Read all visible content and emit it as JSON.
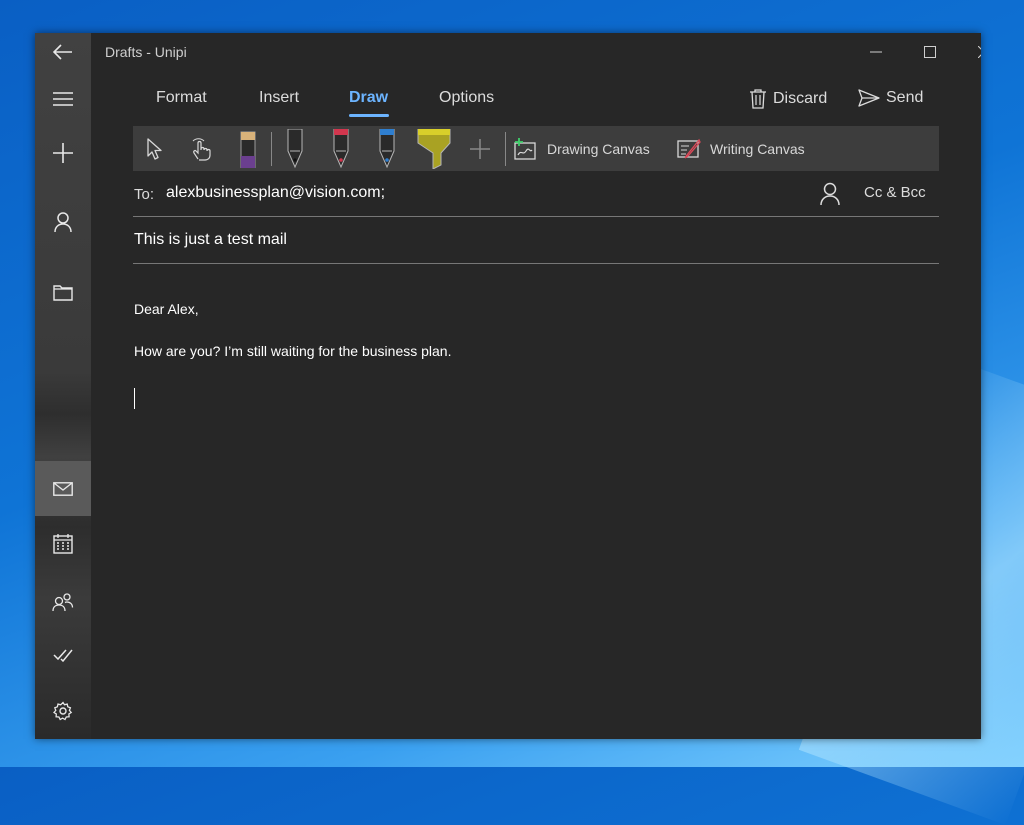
{
  "window": {
    "title": "Drafts - Unipi"
  },
  "rail": {
    "items": [
      {
        "name": "back-button",
        "icon": "back-arrow-icon"
      },
      {
        "name": "menu-button",
        "icon": "hamburger-icon"
      },
      {
        "name": "new-mail-button",
        "icon": "plus-icon"
      },
      {
        "name": "accounts-button",
        "icon": "person-icon"
      },
      {
        "name": "folders-button",
        "icon": "folder-icon"
      },
      {
        "name": "mail-button",
        "icon": "mail-icon",
        "active": true
      },
      {
        "name": "calendar-button",
        "icon": "calendar-icon"
      },
      {
        "name": "people-button",
        "icon": "people-icon"
      },
      {
        "name": "todo-button",
        "icon": "checkmark-icon"
      },
      {
        "name": "settings-button",
        "icon": "gear-icon"
      }
    ]
  },
  "tabs": [
    {
      "label": "Format"
    },
    {
      "label": "Insert"
    },
    {
      "label": "Draw",
      "active": true
    },
    {
      "label": "Options"
    }
  ],
  "actions": {
    "discard": "Discard",
    "send": "Send"
  },
  "draw_toolbar": {
    "tools": [
      "select-icon",
      "touch-draw-icon",
      "eraser-icon",
      "pen-black-icon",
      "pen-red-icon",
      "pen-blue-icon",
      "highlighter-yellow-icon",
      "add-pen-icon"
    ],
    "pen_colors": {
      "eraser": "#6b3f8f",
      "black": "#2a2a2a",
      "red": "#d2364e",
      "blue": "#2f7fd0",
      "highlighter": "#d8cf2a"
    },
    "drawing_canvas": "Drawing Canvas",
    "writing_canvas": "Writing Canvas"
  },
  "compose": {
    "to_label": "To:",
    "to_value": "alexbusinessplan@vision.com;",
    "cc_bcc": "Cc & Bcc",
    "subject": "This is just a test mail",
    "body_lines": [
      "Dear Alex,",
      "How are you? I’m still waiting for the business plan."
    ]
  },
  "colors": {
    "accent": "#6cb4ff",
    "window_bg": "#272727",
    "toolbar_bg": "#3d3d3d"
  }
}
